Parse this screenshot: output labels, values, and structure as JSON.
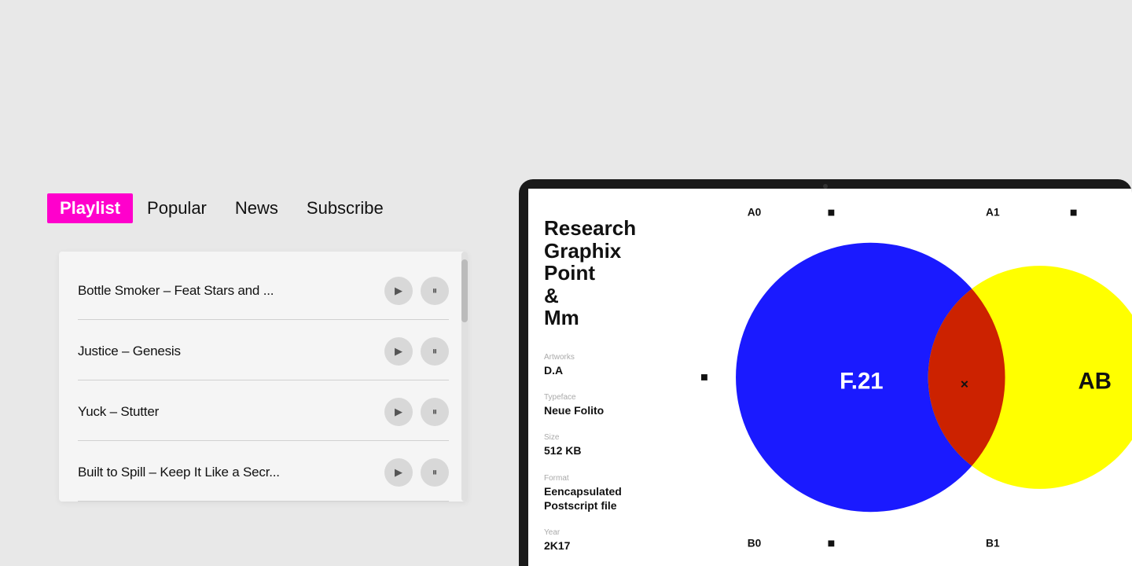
{
  "nav": {
    "tabs": [
      {
        "id": "playlist",
        "label": "Playlist",
        "active": true
      },
      {
        "id": "popular",
        "label": "Popular",
        "active": false
      },
      {
        "id": "news",
        "label": "News",
        "active": false
      },
      {
        "id": "subscribe",
        "label": "Subscribe",
        "active": false
      }
    ]
  },
  "playlist": {
    "tracks": [
      {
        "id": 1,
        "title": "Bottle Smoker –  Feat Stars and ..."
      },
      {
        "id": 2,
        "title": "Justice – Genesis"
      },
      {
        "id": 3,
        "title": "Yuck – Stutter"
      },
      {
        "id": 4,
        "title": "Built to Spill – Keep It Like a Secr..."
      }
    ]
  },
  "device": {
    "info": {
      "title": "Research\nGraphix\nPoint\n&\nMm",
      "artworks_label": "Artworks",
      "artworks_value": "D.A",
      "typeface_label": "Typeface",
      "typeface_value": "Neue Folito",
      "size_label": "Size",
      "size_value": "512 KB",
      "format_label": "Format",
      "format_value": "Eencapsulated\nPostscript file",
      "year_label": "Year",
      "year_value": "2K17"
    },
    "grid": {
      "a0_label": "A0",
      "a1_label": "A1",
      "b0_label": "B0",
      "b1_label": "B1",
      "center_label": "F.21",
      "ab_label": "AB",
      "x_label": "×"
    }
  },
  "controls": {
    "play_icon": "▶",
    "pause_icon": "⏸"
  }
}
